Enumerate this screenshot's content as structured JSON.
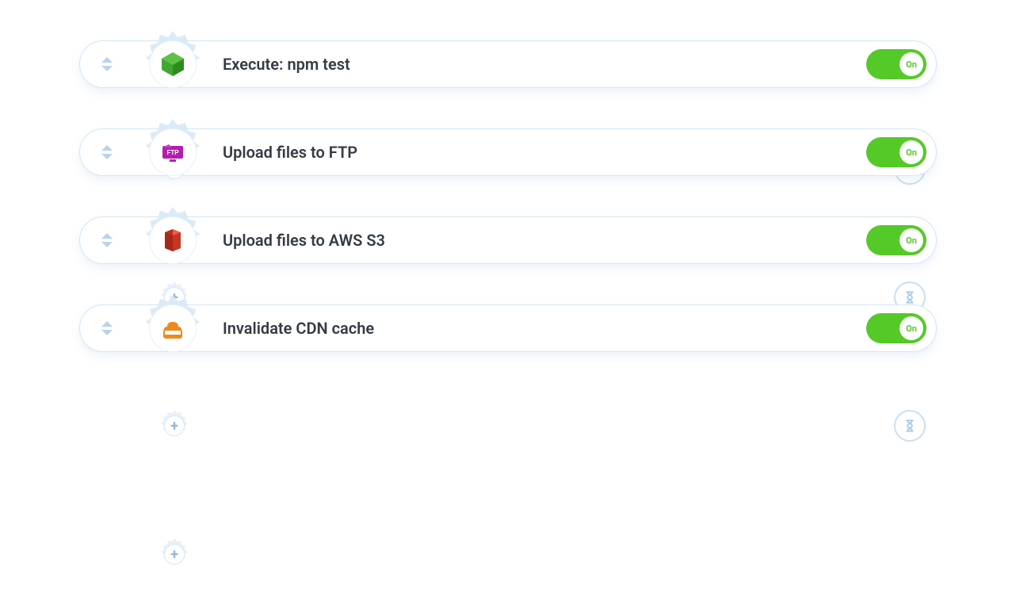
{
  "toggle_label": "On",
  "colors": {
    "accent_green": "#54c928",
    "border_blue": "#d2e5f4",
    "gear_blue": "#dbeaf7",
    "icon_node_green": "#3fa82e",
    "icon_ftp_magenta": "#b21faf",
    "icon_s3_red": "#d13d2a",
    "icon_cdn_orange": "#ec8a1c"
  },
  "steps": [
    {
      "id": "npm-test",
      "label": "Execute: npm test",
      "icon": "node-icon",
      "enabled": true,
      "wait_after": false
    },
    {
      "id": "ftp-upload",
      "label": "Upload files to FTP",
      "icon": "ftp-icon",
      "enabled": true,
      "wait_after": true
    },
    {
      "id": "s3-upload",
      "label": "Upload files to AWS S3",
      "icon": "s3-icon",
      "enabled": true,
      "wait_after": true
    },
    {
      "id": "cdn-invalidate",
      "label": "Invalidate CDN cache",
      "icon": "cdn-icon",
      "enabled": true,
      "wait_after": true
    }
  ]
}
